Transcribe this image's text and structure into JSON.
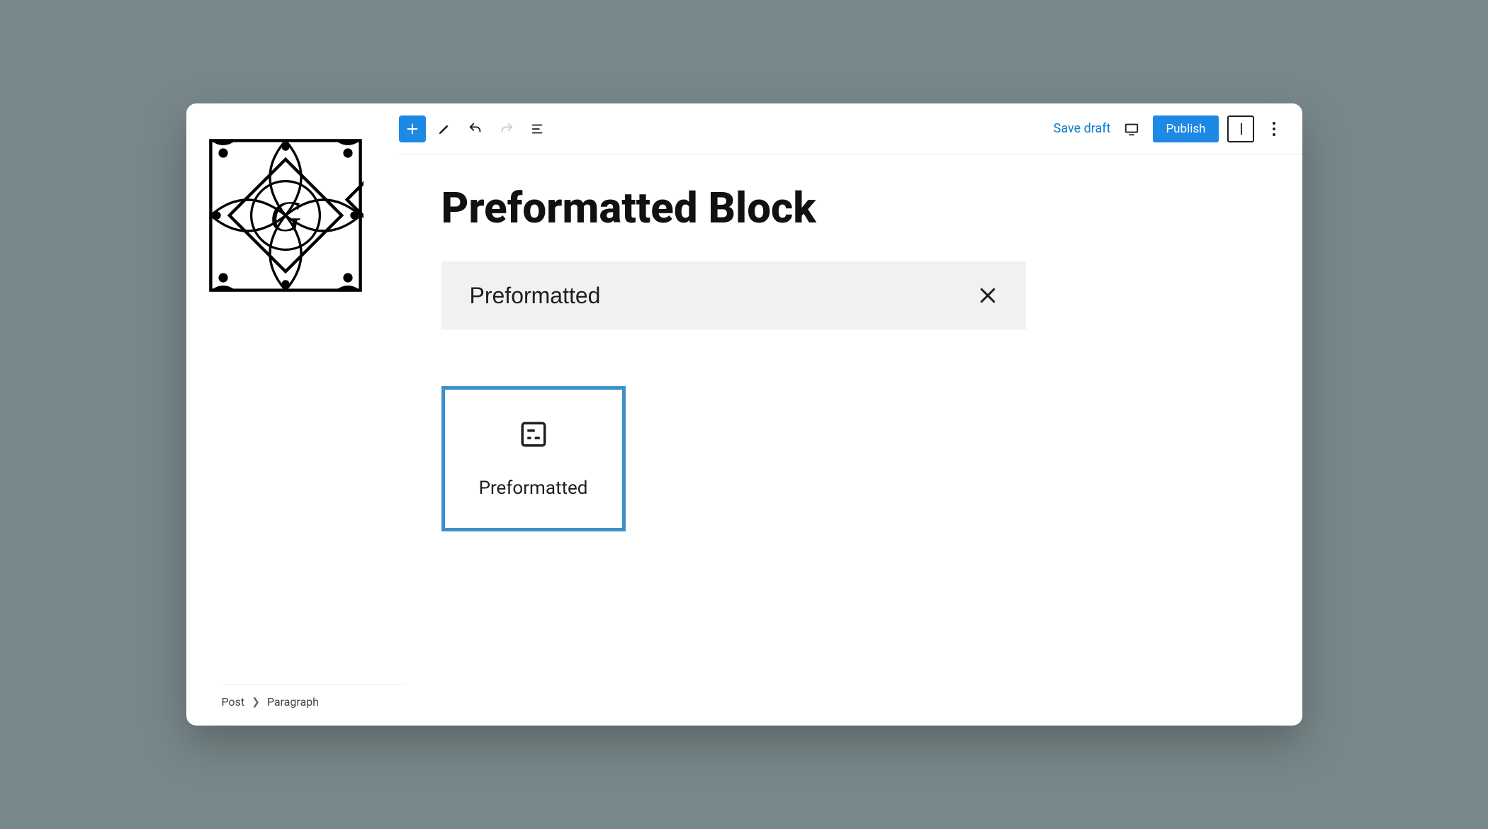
{
  "toolbar": {
    "save_draft_label": "Save draft",
    "publish_label": "Publish"
  },
  "editor": {
    "title": "Preformatted Block",
    "search_value": "Preformatted"
  },
  "results": {
    "block_label": "Preformatted"
  },
  "breadcrumb": {
    "root": "Post",
    "current": "Paragraph"
  }
}
